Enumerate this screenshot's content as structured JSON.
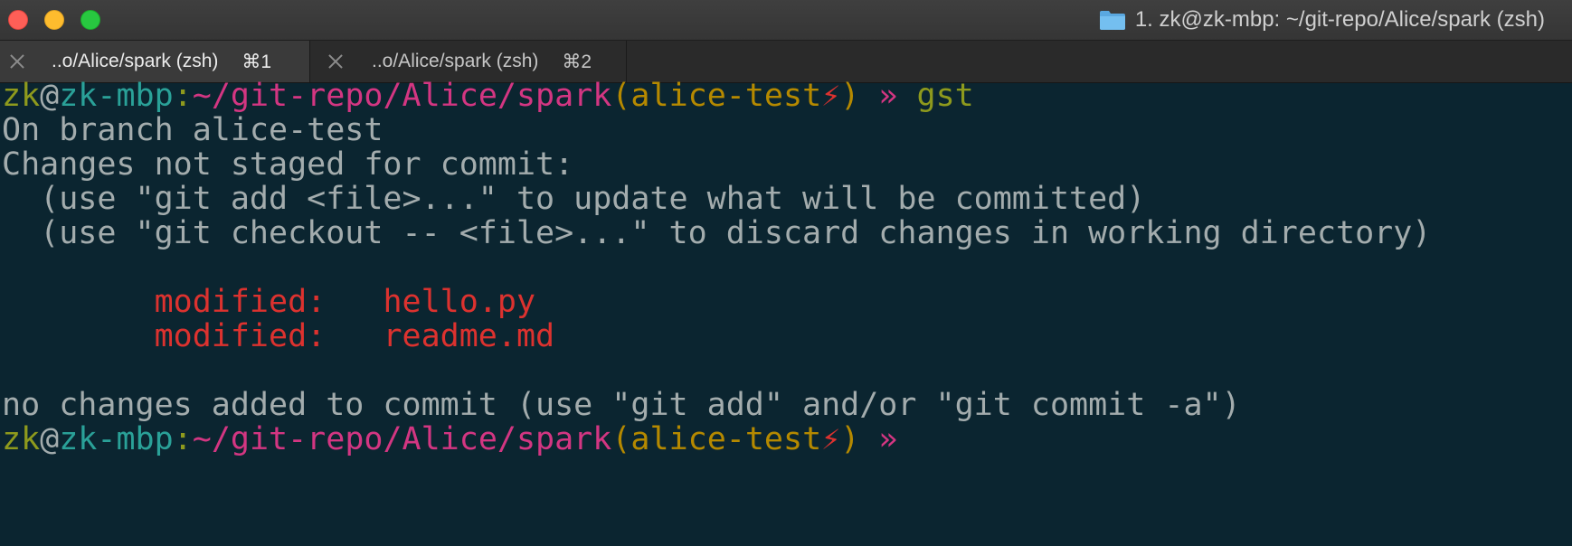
{
  "window": {
    "title": "1. zk@zk-mbp: ~/git-repo/Alice/spark (zsh)",
    "title_icon": "folder-icon"
  },
  "tabs": [
    {
      "label": "..o/Alice/spark (zsh)",
      "shortcut": "⌘1",
      "active": true
    },
    {
      "label": "..o/Alice/spark (zsh)",
      "shortcut": "⌘2",
      "active": false
    }
  ],
  "prompt": {
    "user": "zk",
    "at": "@",
    "host": "zk-mbp",
    "colon": ":",
    "path": "~/git-repo/Alice/spark",
    "open_paren": "(",
    "branch": "alice-test",
    "bolt": "⚡",
    "close_paren": ")",
    "arrow": " » "
  },
  "terminal": {
    "command": "gst",
    "output": {
      "branch_line": "On branch alice-test",
      "changes_header": "Changes not staged for commit:",
      "hint_add": "  (use \"git add <file>...\" to update what will be committed)",
      "hint_checkout": "  (use \"git checkout -- <file>...\" to discard changes in working directory)",
      "modified_files": [
        {
          "status": "        modified:   ",
          "file": "hello.py"
        },
        {
          "status": "        modified:   ",
          "file": "readme.md"
        }
      ],
      "summary": "no changes added to commit (use \"git add\" and/or \"git commit -a\")"
    }
  },
  "colors": {
    "background": "#0b2530",
    "user": "#8e9a1d",
    "host": "#2aa198",
    "path": "#d33682",
    "branch": "#b58900",
    "modified": "#dc322f",
    "text": "#a3acad"
  }
}
